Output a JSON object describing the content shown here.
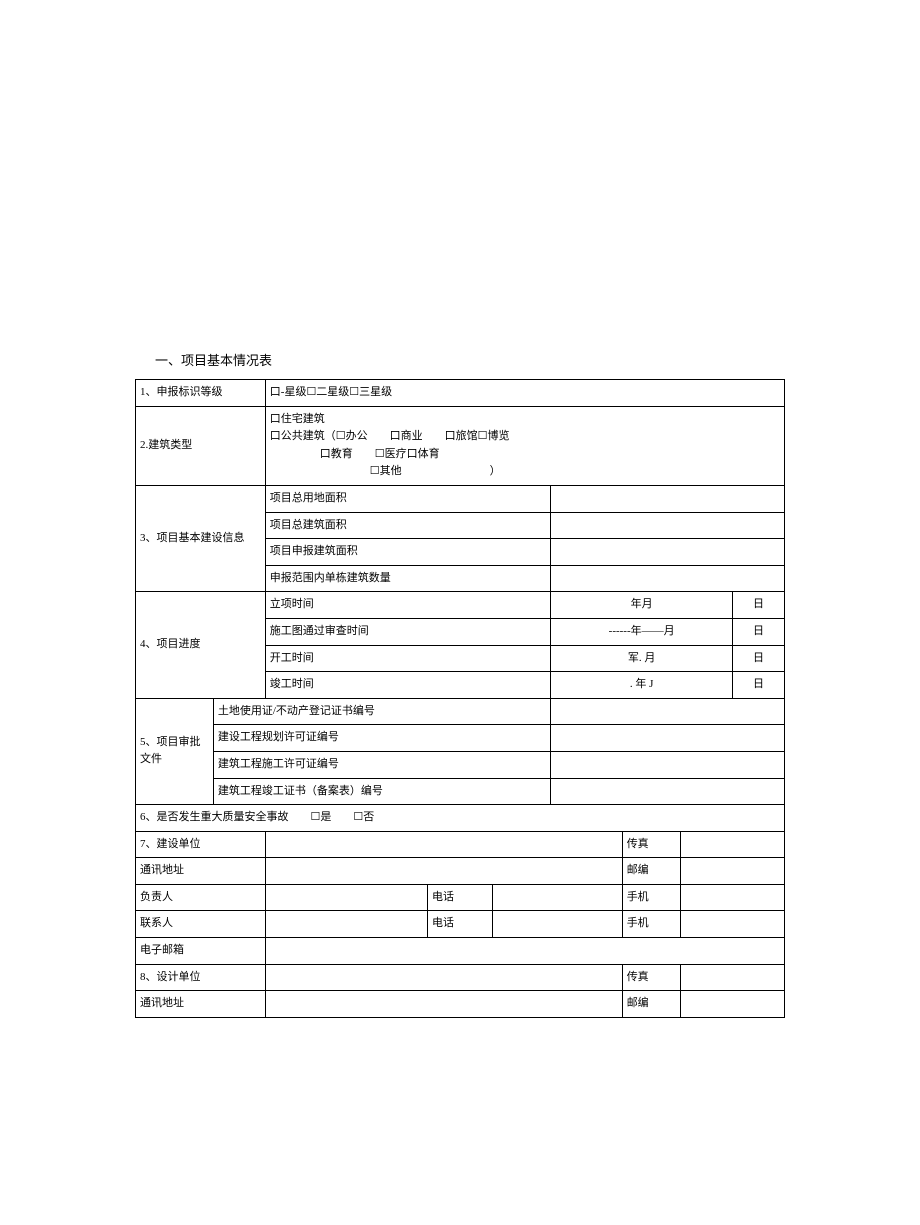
{
  "title": "一、项目基本情况表",
  "rows": {
    "r1_label": "1、申报标识等级",
    "r1_val": "口-星级☐二星级☐三星级",
    "r2_label": "2.建筑类型",
    "r2_line1": "口住宅建筑",
    "r2_line2": "口公共建筑（☐办公  口商业  口旅馆☐博览",
    "r2_line3": "口教育  ☐医疗口体育",
    "r2_line4": "☐其他        ）",
    "r3_label": "3、项目基本建设信息",
    "r3_a": "项目总用地面积",
    "r3_b": "项目总建筑面积",
    "r3_c": "项目申报建筑面积",
    "r3_d": "申报范围内单栋建筑数量",
    "r4_label": "4、项目进度",
    "r4_a": "立项时间",
    "r4_a_v1": "年月",
    "r4_a_v2": "日",
    "r4_b": "施工图通过审查时间",
    "r4_b_v1": "------年——月",
    "r4_b_v2": "日",
    "r4_c": "开工时间",
    "r4_c_v1": "军. 月",
    "r4_c_v2": "日",
    "r4_d": "竣工时间",
    "r4_d_v1": ". 年 J",
    "r4_d_v2": "日",
    "r5_label": "5、项目审批文件",
    "r5_a": "土地使用证/不动产登记证书编号",
    "r5_b": "建设工程规划许可证编号",
    "r5_c": "建筑工程施工许可证编号",
    "r5_d": "建筑工程竣工证书（备案表）编号",
    "r6": "6、是否发生重大质量安全事故  ☐是  ☐否",
    "r7": "7、建设单位",
    "fax": "传真",
    "addr": "通讯地址",
    "post": "邮编",
    "head": "负责人",
    "tel": "电话",
    "mobile": "手机",
    "contact": "联系人",
    "email": "电子邮箱",
    "r8": "8、设计单位"
  }
}
